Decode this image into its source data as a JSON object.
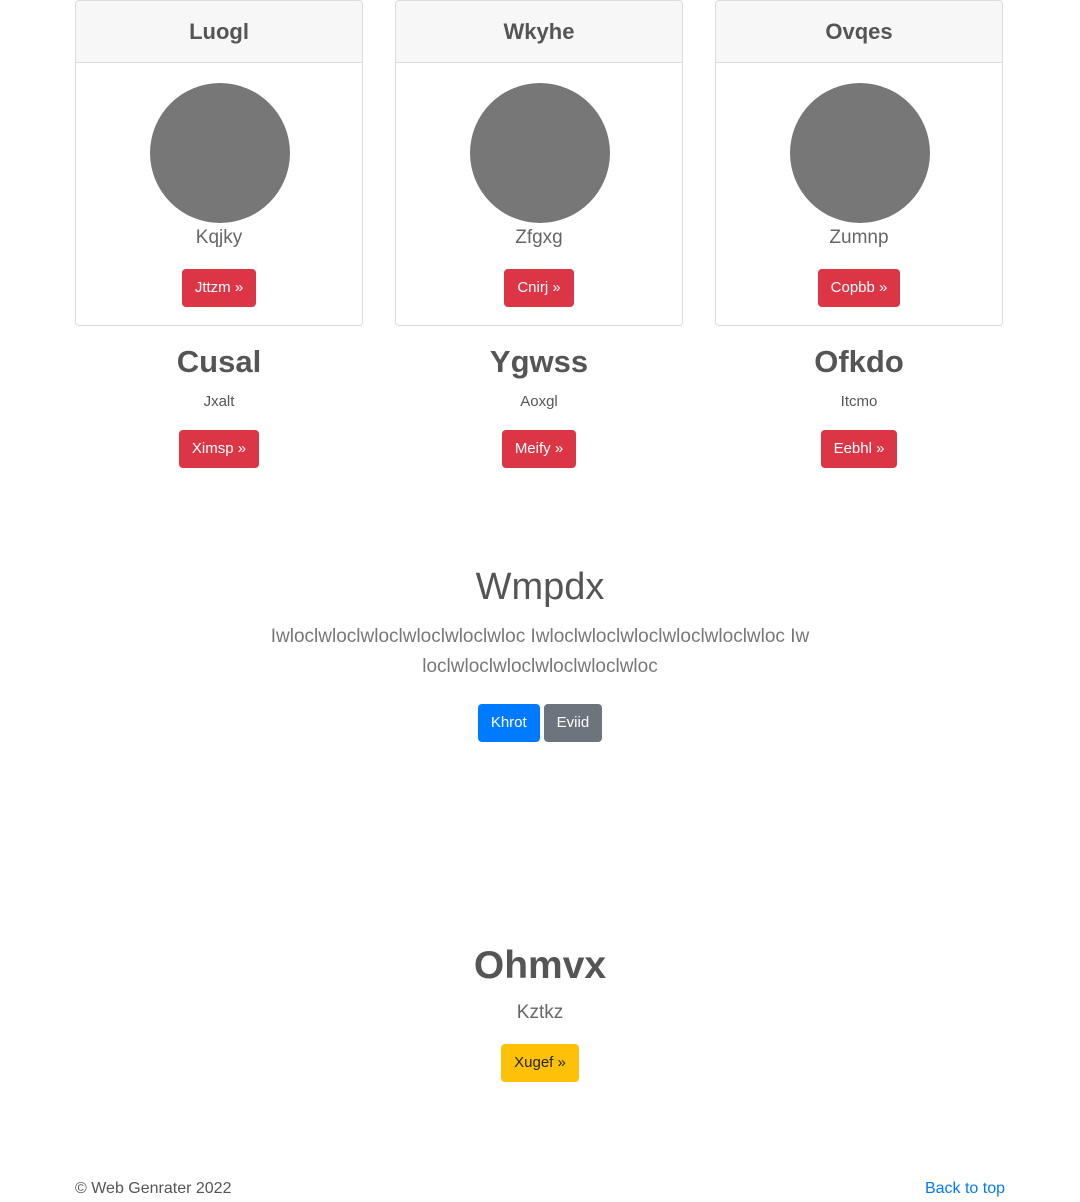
{
  "cards": [
    {
      "title": "Luogl",
      "subtitle": "Kqjky",
      "button": "Jttzm »"
    },
    {
      "title": "Wkyhe",
      "subtitle": "Zfgxg",
      "button": "Cnirj »"
    },
    {
      "title": "Ovqes",
      "subtitle": "Zumnp",
      "button": "Copbb »"
    }
  ],
  "columns": [
    {
      "title": "Cusal",
      "subtitle": "Jxalt",
      "button": "Ximsp »"
    },
    {
      "title": "Ygwss",
      "subtitle": "Aoxgl",
      "button": "Meify »"
    },
    {
      "title": "Ofkdo",
      "subtitle": "Itcmo",
      "button": "Eebhl »"
    }
  ],
  "hero": {
    "title": "Wmpdx",
    "text": "Iwloclwloclwloclwloclwloclwloc Iwloclwloclwloclwloclwloclwloc Iwloclwloclwloclwloclwloclwloc",
    "primary_button": "Khrot",
    "secondary_button": "Eviid"
  },
  "bottom": {
    "title": "Ohmvx",
    "subtitle": "Kztkz",
    "button": "Xugef »"
  },
  "footer": {
    "copyright": "© Web Genrater 2022",
    "back_to_top": "Back to top"
  },
  "colors": {
    "danger": "#dc3545",
    "primary": "#007bff",
    "secondary": "#6c757d",
    "warning": "#ffc107",
    "avatar": "#777777"
  }
}
